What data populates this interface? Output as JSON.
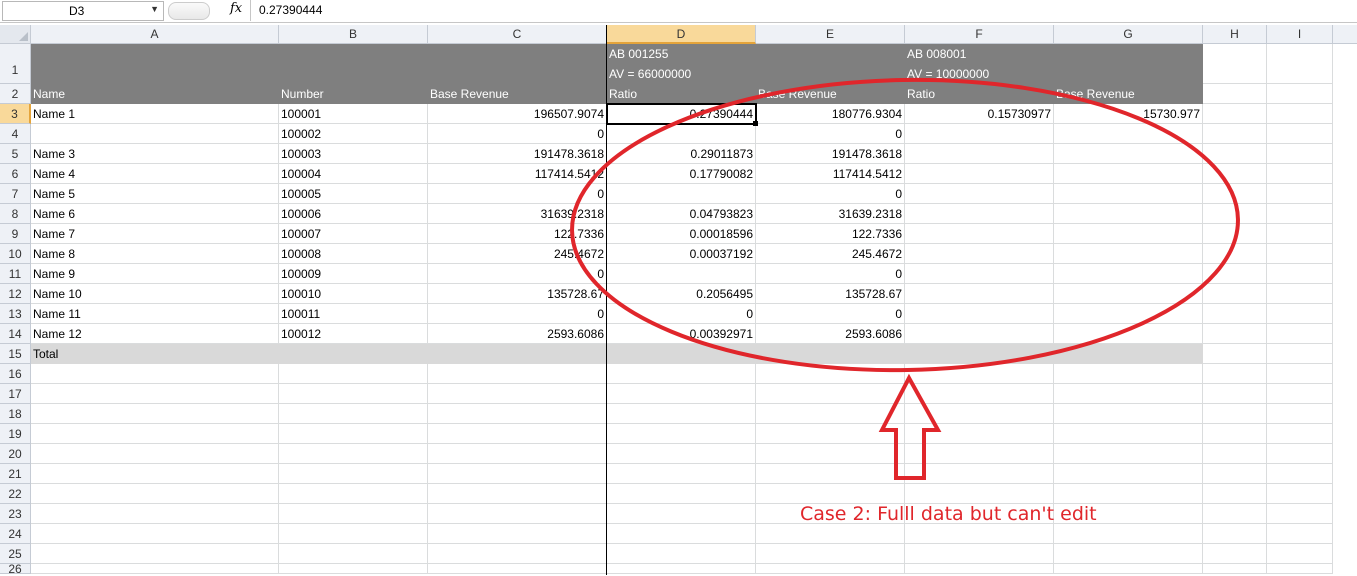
{
  "formula_bar": {
    "name_box": "D3",
    "fx_label": "fx",
    "formula": "0.27390444"
  },
  "columns": [
    "A",
    "B",
    "C",
    "D",
    "E",
    "F",
    "G",
    "H",
    "I"
  ],
  "selected_column": "D",
  "selected_row": "3",
  "rows": [
    {
      "n": "1",
      "cells": {
        "A": "",
        "B": "",
        "C": "",
        "D": "AB 001255\nAV = 66000000",
        "E": "",
        "F": "AB 008001\nAV = 10000000",
        "G": ""
      }
    },
    {
      "n": "2",
      "cells": {
        "A": "Name",
        "B": "Number",
        "C": "Base Revenue",
        "D": "Ratio",
        "E": "Base Revenue",
        "F": "Ratio",
        "G": "Base Revenue"
      }
    },
    {
      "n": "3",
      "cells": {
        "A": "Name 1",
        "B": "100001",
        "C": "196507.9074",
        "D": "0.27390444",
        "E": "180776.9304",
        "F": "0.15730977",
        "G": "15730.977"
      }
    },
    {
      "n": "4",
      "cells": {
        "A": "",
        "B": "100002",
        "C": "0",
        "D": "",
        "E": "0",
        "F": "",
        "G": ""
      }
    },
    {
      "n": "5",
      "cells": {
        "A": "Name 3",
        "B": "100003",
        "C": "191478.3618",
        "D": "0.29011873",
        "E": "191478.3618",
        "F": "",
        "G": ""
      }
    },
    {
      "n": "6",
      "cells": {
        "A": "Name 4",
        "B": "100004",
        "C": "117414.5412",
        "D": "0.17790082",
        "E": "117414.5412",
        "F": "",
        "G": ""
      }
    },
    {
      "n": "7",
      "cells": {
        "A": "Name 5",
        "B": "100005",
        "C": "0",
        "D": "",
        "E": "0",
        "F": "",
        "G": ""
      }
    },
    {
      "n": "8",
      "cells": {
        "A": "Name 6",
        "B": "100006",
        "C": "31639.2318",
        "D": "0.04793823",
        "E": "31639.2318",
        "F": "",
        "G": ""
      }
    },
    {
      "n": "9",
      "cells": {
        "A": "Name 7",
        "B": "100007",
        "C": "122.7336",
        "D": "0.00018596",
        "E": "122.7336",
        "F": "",
        "G": ""
      }
    },
    {
      "n": "10",
      "cells": {
        "A": "Name 8",
        "B": "100008",
        "C": "245.4672",
        "D": "0.00037192",
        "E": "245.4672",
        "F": "",
        "G": ""
      }
    },
    {
      "n": "11",
      "cells": {
        "A": "Name 9",
        "B": "100009",
        "C": "0",
        "D": "",
        "E": "0",
        "F": "",
        "G": ""
      }
    },
    {
      "n": "12",
      "cells": {
        "A": "Name 10",
        "B": "100010",
        "C": "135728.67",
        "D": "0.2056495",
        "E": "135728.67",
        "F": "",
        "G": ""
      }
    },
    {
      "n": "13",
      "cells": {
        "A": "Name 11",
        "B": "100011",
        "C": "0",
        "D": "0",
        "E": "0",
        "F": "",
        "G": ""
      }
    },
    {
      "n": "14",
      "cells": {
        "A": "Name 12",
        "B": "100012",
        "C": "2593.6086",
        "D": "0.00392971",
        "E": "2593.6086",
        "F": "",
        "G": ""
      }
    },
    {
      "n": "15",
      "cells": {
        "A": "Total",
        "B": "",
        "C": "",
        "D": "",
        "E": "",
        "F": "",
        "G": ""
      }
    },
    {
      "n": "16",
      "cells": {}
    },
    {
      "n": "17",
      "cells": {}
    },
    {
      "n": "18",
      "cells": {}
    },
    {
      "n": "19",
      "cells": {}
    },
    {
      "n": "20",
      "cells": {}
    },
    {
      "n": "21",
      "cells": {}
    },
    {
      "n": "22",
      "cells": {}
    },
    {
      "n": "23",
      "cells": {}
    },
    {
      "n": "24",
      "cells": {}
    },
    {
      "n": "25",
      "cells": {}
    },
    {
      "n": "26",
      "cells": {}
    }
  ],
  "annotation": {
    "text": "Case 2: Fulll data but can't edit",
    "color": "#e0262b"
  }
}
